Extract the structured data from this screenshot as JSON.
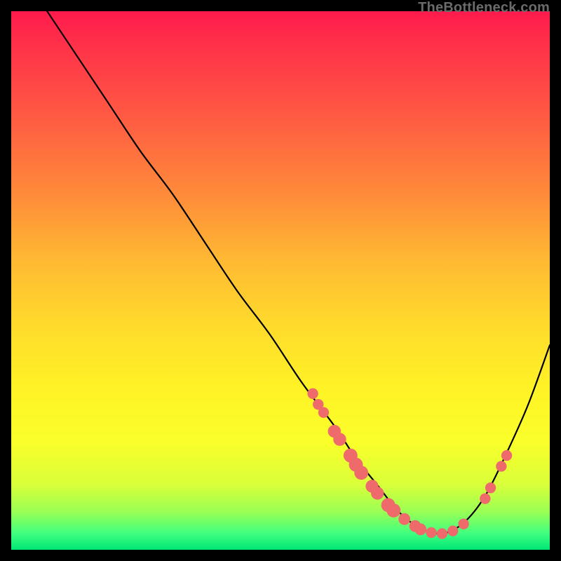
{
  "attribution": "TheBottleneck.com",
  "colors": {
    "marker": "#ef6a6a",
    "curve": "#000000"
  },
  "chart_data": {
    "type": "line",
    "title": "",
    "xlabel": "",
    "ylabel": "",
    "xlim": [
      0,
      100
    ],
    "ylim": [
      0,
      100
    ],
    "grid": false,
    "legend": false,
    "series": [
      {
        "name": "bottleneck-curve",
        "x": [
          0,
          6,
          12,
          18,
          24,
          30,
          36,
          42,
          48,
          54,
          60,
          64,
          68,
          72,
          76,
          80,
          84,
          88,
          92,
          96,
          100
        ],
        "y": [
          110,
          101,
          92,
          83,
          74,
          66,
          57,
          48,
          40,
          31,
          23,
          17,
          12,
          7,
          4,
          3,
          5,
          10,
          18,
          27,
          38
        ]
      }
    ],
    "markers": [
      {
        "x": 56,
        "y": 29,
        "r": 1.0
      },
      {
        "x": 57,
        "y": 27,
        "r": 1.0
      },
      {
        "x": 58,
        "y": 25.5,
        "r": 1.0
      },
      {
        "x": 60,
        "y": 22,
        "r": 1.2
      },
      {
        "x": 61,
        "y": 20.5,
        "r": 1.2
      },
      {
        "x": 63,
        "y": 17.5,
        "r": 1.3
      },
      {
        "x": 64,
        "y": 15.8,
        "r": 1.3
      },
      {
        "x": 65,
        "y": 14.3,
        "r": 1.3
      },
      {
        "x": 67,
        "y": 11.8,
        "r": 1.2
      },
      {
        "x": 68,
        "y": 10.5,
        "r": 1.2
      },
      {
        "x": 70,
        "y": 8.3,
        "r": 1.3
      },
      {
        "x": 71,
        "y": 7.3,
        "r": 1.3
      },
      {
        "x": 73,
        "y": 5.7,
        "r": 1.1
      },
      {
        "x": 75,
        "y": 4.4,
        "r": 1.1
      },
      {
        "x": 76,
        "y": 3.8,
        "r": 1.1
      },
      {
        "x": 78,
        "y": 3.2,
        "r": 1.0
      },
      {
        "x": 80,
        "y": 3.0,
        "r": 1.0
      },
      {
        "x": 82,
        "y": 3.5,
        "r": 1.0
      },
      {
        "x": 84,
        "y": 4.8,
        "r": 1.0
      },
      {
        "x": 88,
        "y": 9.5,
        "r": 1.0
      },
      {
        "x": 89,
        "y": 11.5,
        "r": 1.0
      },
      {
        "x": 91,
        "y": 15.5,
        "r": 1.0
      },
      {
        "x": 92,
        "y": 17.5,
        "r": 1.0
      }
    ]
  }
}
